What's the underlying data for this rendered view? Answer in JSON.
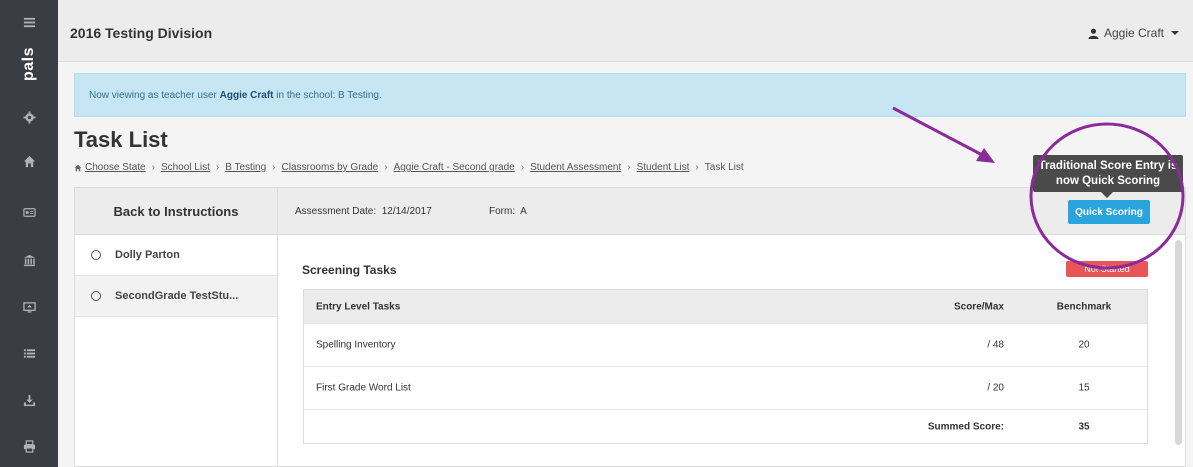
{
  "sidebar": {
    "logo": "pals",
    "items": [
      {
        "icon": "menu-icon"
      },
      {
        "icon": "gear-icon"
      },
      {
        "icon": "home-icon"
      },
      {
        "icon": "id-card-icon"
      },
      {
        "icon": "institution-icon"
      },
      {
        "icon": "monitor-icon"
      },
      {
        "icon": "list-icon"
      },
      {
        "icon": "download-icon"
      },
      {
        "icon": "print-icon"
      }
    ]
  },
  "header": {
    "title": "2016 Testing Division",
    "user": "Aggie Craft"
  },
  "alert": {
    "prefix": "Now viewing as teacher user ",
    "user": "Aggie Craft",
    "suffix": " in the school: B Testing."
  },
  "page": {
    "title": "Task List"
  },
  "breadcrumb": {
    "items": [
      "Choose State",
      "School List",
      "B Testing",
      "Classrooms by Grade",
      "Aggie Craft - Second grade",
      "Student Assessment",
      "Student List"
    ],
    "current": "Task List",
    "separator": "›"
  },
  "left_panel": {
    "back_label": "Back to Instructions",
    "students": [
      "Dolly Parton",
      "SecondGrade TestStu..."
    ]
  },
  "info_bar": {
    "date_label": "Assessment Date:",
    "date_value": "12/14/2017",
    "form_label": "Form:",
    "form_value": "A",
    "quick_scoring_label": "Quick Scoring"
  },
  "screening": {
    "title": "Screening Tasks",
    "status": "Not Started",
    "columns": [
      "Entry Level Tasks",
      "Score/Max",
      "Benchmark"
    ],
    "rows": [
      {
        "task": "Spelling Inventory",
        "score": "/ 48",
        "benchmark": "20"
      },
      {
        "task": "First Grade Word List",
        "score": "/ 20",
        "benchmark": "15"
      }
    ],
    "summed_label": "Summed Score:",
    "summed_value": "35"
  },
  "annotation": {
    "tooltip_line1": "Traditional Score Entry is",
    "tooltip_line2": "now Quick Scoring",
    "color": "#8b2a9b"
  },
  "colors": {
    "sidebar": "#3a3d44",
    "accent": "#2aa4dd",
    "danger": "#e95458",
    "alert_bg": "#c7e6f3"
  }
}
